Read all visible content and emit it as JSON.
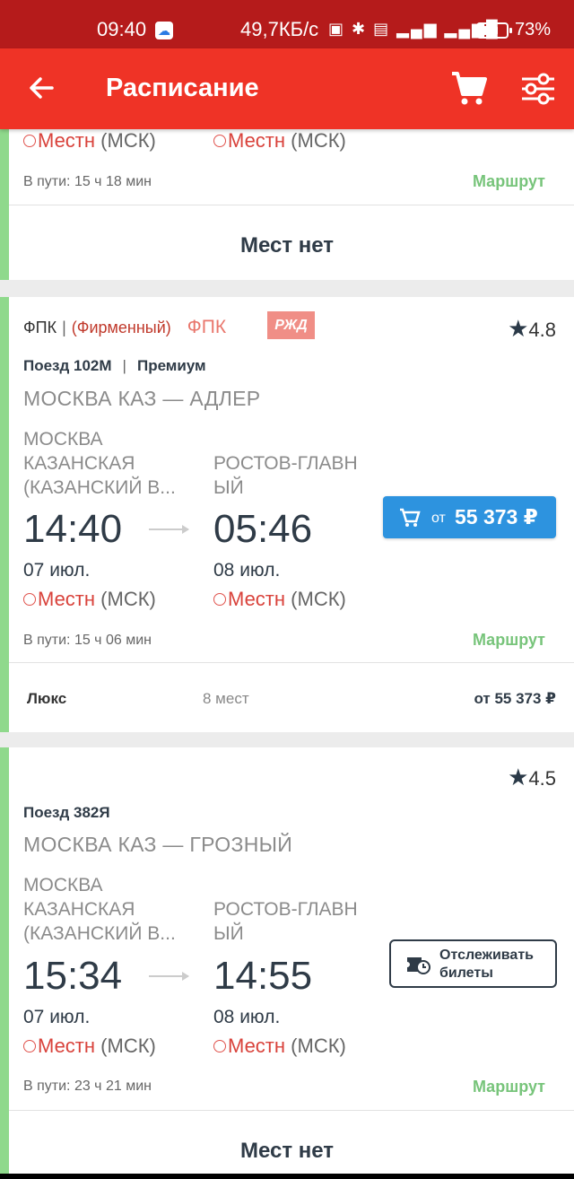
{
  "status_bar": {
    "time": "09:40",
    "network_speed": "49,7КБ/с",
    "battery": "73%",
    "battery_level": 0.73
  },
  "app_bar": {
    "title": "Расписание",
    "back_icon": "arrow-left-icon",
    "cart_icon": "cart-icon",
    "filter_icon": "sliders-icon"
  },
  "common": {
    "local_label": "Местн",
    "msk_label": "(МСК)",
    "route_label": "Маршрут",
    "no_seats": "Мест нет"
  },
  "trains": [
    {
      "duration": "В пути: 15 ч 18 мин"
    },
    {
      "carrier": "ФПК",
      "category": "(Фирменный)",
      "carrier_logo": "ФПК",
      "rzd_logo": "РЖД",
      "rating": "4.8",
      "train_number": "Поезд 102М",
      "train_class": "Премиум",
      "route": "МОСКВА КАЗ — АДЛЕР",
      "from_station_lines": [
        "МОСКВА",
        "КАЗАНСКАЯ",
        "(КАЗАНСКИЙ В..."
      ],
      "to_station_lines": [
        "РОСТОВ-ГЛАВН",
        "ЫЙ"
      ],
      "depart_time": "14:40",
      "arrive_time": "05:46",
      "depart_date": "07 июл.",
      "arrive_date": "08 июл.",
      "price_from": "от",
      "price": "55 373 ₽",
      "duration": "В пути: 15 ч 06 мин",
      "coach_class": "Люкс",
      "coach_seats": "8 мест",
      "coach_price": "от 55 373 ₽"
    },
    {
      "rating": "4.5",
      "train_number": "Поезд 382Я",
      "route": "МОСКВА КАЗ — ГРОЗНЫЙ",
      "from_station_lines": [
        "МОСКВА",
        "КАЗАНСКАЯ",
        "(КАЗАНСКИЙ В..."
      ],
      "to_station_lines": [
        "РОСТОВ-ГЛАВН",
        "ЫЙ"
      ],
      "depart_time": "15:34",
      "arrive_time": "14:55",
      "depart_date": "07 июл.",
      "arrive_date": "08 июл.",
      "track_line1": "Отслеживать",
      "track_line2": "билеты",
      "duration": "В пути: 23 ч 21 мин"
    }
  ],
  "colors": {
    "status_bar": "#b51b1b",
    "app_bar": "#ef3326",
    "price_button": "#2d93df",
    "route_link": "#77c47a",
    "stripe": "#8fd98c",
    "local_red": "#d9423b"
  }
}
